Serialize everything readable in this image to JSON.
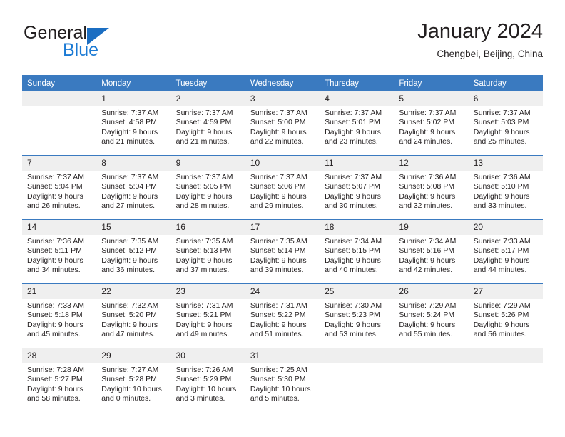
{
  "brand": {
    "name_top": "General",
    "name_bottom": "Blue",
    "triangle_color": "#1b6ec2",
    "blue_color": "#1b7ad4"
  },
  "header": {
    "title": "January 2024",
    "location": "Chengbei, Beijing, China"
  },
  "theme": {
    "header_bg": "#3a7ac0",
    "daynum_bg": "#efefef",
    "text": "#231f20"
  },
  "weekdays": [
    "Sunday",
    "Monday",
    "Tuesday",
    "Wednesday",
    "Thursday",
    "Friday",
    "Saturday"
  ],
  "labels": {
    "sunrise": "Sunrise:",
    "sunset": "Sunset:",
    "daylight": "Daylight:"
  },
  "weeks": [
    [
      {
        "day": "",
        "empty": true
      },
      {
        "day": "1",
        "sunrise": "Sunrise: 7:37 AM",
        "sunset": "Sunset: 4:58 PM",
        "daylight1": "Daylight: 9 hours",
        "daylight2": "and 21 minutes."
      },
      {
        "day": "2",
        "sunrise": "Sunrise: 7:37 AM",
        "sunset": "Sunset: 4:59 PM",
        "daylight1": "Daylight: 9 hours",
        "daylight2": "and 21 minutes."
      },
      {
        "day": "3",
        "sunrise": "Sunrise: 7:37 AM",
        "sunset": "Sunset: 5:00 PM",
        "daylight1": "Daylight: 9 hours",
        "daylight2": "and 22 minutes."
      },
      {
        "day": "4",
        "sunrise": "Sunrise: 7:37 AM",
        "sunset": "Sunset: 5:01 PM",
        "daylight1": "Daylight: 9 hours",
        "daylight2": "and 23 minutes."
      },
      {
        "day": "5",
        "sunrise": "Sunrise: 7:37 AM",
        "sunset": "Sunset: 5:02 PM",
        "daylight1": "Daylight: 9 hours",
        "daylight2": "and 24 minutes."
      },
      {
        "day": "6",
        "sunrise": "Sunrise: 7:37 AM",
        "sunset": "Sunset: 5:03 PM",
        "daylight1": "Daylight: 9 hours",
        "daylight2": "and 25 minutes."
      }
    ],
    [
      {
        "day": "7",
        "sunrise": "Sunrise: 7:37 AM",
        "sunset": "Sunset: 5:04 PM",
        "daylight1": "Daylight: 9 hours",
        "daylight2": "and 26 minutes."
      },
      {
        "day": "8",
        "sunrise": "Sunrise: 7:37 AM",
        "sunset": "Sunset: 5:04 PM",
        "daylight1": "Daylight: 9 hours",
        "daylight2": "and 27 minutes."
      },
      {
        "day": "9",
        "sunrise": "Sunrise: 7:37 AM",
        "sunset": "Sunset: 5:05 PM",
        "daylight1": "Daylight: 9 hours",
        "daylight2": "and 28 minutes."
      },
      {
        "day": "10",
        "sunrise": "Sunrise: 7:37 AM",
        "sunset": "Sunset: 5:06 PM",
        "daylight1": "Daylight: 9 hours",
        "daylight2": "and 29 minutes."
      },
      {
        "day": "11",
        "sunrise": "Sunrise: 7:37 AM",
        "sunset": "Sunset: 5:07 PM",
        "daylight1": "Daylight: 9 hours",
        "daylight2": "and 30 minutes."
      },
      {
        "day": "12",
        "sunrise": "Sunrise: 7:36 AM",
        "sunset": "Sunset: 5:08 PM",
        "daylight1": "Daylight: 9 hours",
        "daylight2": "and 32 minutes."
      },
      {
        "day": "13",
        "sunrise": "Sunrise: 7:36 AM",
        "sunset": "Sunset: 5:10 PM",
        "daylight1": "Daylight: 9 hours",
        "daylight2": "and 33 minutes."
      }
    ],
    [
      {
        "day": "14",
        "sunrise": "Sunrise: 7:36 AM",
        "sunset": "Sunset: 5:11 PM",
        "daylight1": "Daylight: 9 hours",
        "daylight2": "and 34 minutes."
      },
      {
        "day": "15",
        "sunrise": "Sunrise: 7:35 AM",
        "sunset": "Sunset: 5:12 PM",
        "daylight1": "Daylight: 9 hours",
        "daylight2": "and 36 minutes."
      },
      {
        "day": "16",
        "sunrise": "Sunrise: 7:35 AM",
        "sunset": "Sunset: 5:13 PM",
        "daylight1": "Daylight: 9 hours",
        "daylight2": "and 37 minutes."
      },
      {
        "day": "17",
        "sunrise": "Sunrise: 7:35 AM",
        "sunset": "Sunset: 5:14 PM",
        "daylight1": "Daylight: 9 hours",
        "daylight2": "and 39 minutes."
      },
      {
        "day": "18",
        "sunrise": "Sunrise: 7:34 AM",
        "sunset": "Sunset: 5:15 PM",
        "daylight1": "Daylight: 9 hours",
        "daylight2": "and 40 minutes."
      },
      {
        "day": "19",
        "sunrise": "Sunrise: 7:34 AM",
        "sunset": "Sunset: 5:16 PM",
        "daylight1": "Daylight: 9 hours",
        "daylight2": "and 42 minutes."
      },
      {
        "day": "20",
        "sunrise": "Sunrise: 7:33 AM",
        "sunset": "Sunset: 5:17 PM",
        "daylight1": "Daylight: 9 hours",
        "daylight2": "and 44 minutes."
      }
    ],
    [
      {
        "day": "21",
        "sunrise": "Sunrise: 7:33 AM",
        "sunset": "Sunset: 5:18 PM",
        "daylight1": "Daylight: 9 hours",
        "daylight2": "and 45 minutes."
      },
      {
        "day": "22",
        "sunrise": "Sunrise: 7:32 AM",
        "sunset": "Sunset: 5:20 PM",
        "daylight1": "Daylight: 9 hours",
        "daylight2": "and 47 minutes."
      },
      {
        "day": "23",
        "sunrise": "Sunrise: 7:31 AM",
        "sunset": "Sunset: 5:21 PM",
        "daylight1": "Daylight: 9 hours",
        "daylight2": "and 49 minutes."
      },
      {
        "day": "24",
        "sunrise": "Sunrise: 7:31 AM",
        "sunset": "Sunset: 5:22 PM",
        "daylight1": "Daylight: 9 hours",
        "daylight2": "and 51 minutes."
      },
      {
        "day": "25",
        "sunrise": "Sunrise: 7:30 AM",
        "sunset": "Sunset: 5:23 PM",
        "daylight1": "Daylight: 9 hours",
        "daylight2": "and 53 minutes."
      },
      {
        "day": "26",
        "sunrise": "Sunrise: 7:29 AM",
        "sunset": "Sunset: 5:24 PM",
        "daylight1": "Daylight: 9 hours",
        "daylight2": "and 55 minutes."
      },
      {
        "day": "27",
        "sunrise": "Sunrise: 7:29 AM",
        "sunset": "Sunset: 5:26 PM",
        "daylight1": "Daylight: 9 hours",
        "daylight2": "and 56 minutes."
      }
    ],
    [
      {
        "day": "28",
        "sunrise": "Sunrise: 7:28 AM",
        "sunset": "Sunset: 5:27 PM",
        "daylight1": "Daylight: 9 hours",
        "daylight2": "and 58 minutes."
      },
      {
        "day": "29",
        "sunrise": "Sunrise: 7:27 AM",
        "sunset": "Sunset: 5:28 PM",
        "daylight1": "Daylight: 10 hours",
        "daylight2": "and 0 minutes."
      },
      {
        "day": "30",
        "sunrise": "Sunrise: 7:26 AM",
        "sunset": "Sunset: 5:29 PM",
        "daylight1": "Daylight: 10 hours",
        "daylight2": "and 3 minutes."
      },
      {
        "day": "31",
        "sunrise": "Sunrise: 7:25 AM",
        "sunset": "Sunset: 5:30 PM",
        "daylight1": "Daylight: 10 hours",
        "daylight2": "and 5 minutes."
      },
      {
        "day": "",
        "empty": true
      },
      {
        "day": "",
        "empty": true
      },
      {
        "day": "",
        "empty": true
      }
    ]
  ]
}
